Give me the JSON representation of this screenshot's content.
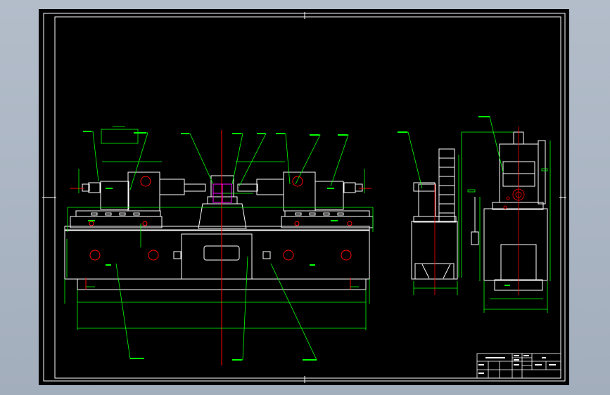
{
  "viewer": {
    "background_color": "#a9b4c2",
    "canvas_color": "#000000",
    "frame_color": "#ffffff"
  },
  "drawing": {
    "colors": {
      "outline": "#ffffff",
      "dimension": "#00ff00",
      "centerline": "#ff0000",
      "highlight": "#ff00ff",
      "leader": "#00ff00"
    }
  },
  "title_block": {
    "labels": [
      "",
      "",
      "",
      "",
      "",
      "",
      "",
      "",
      "",
      "",
      "",
      ""
    ]
  }
}
